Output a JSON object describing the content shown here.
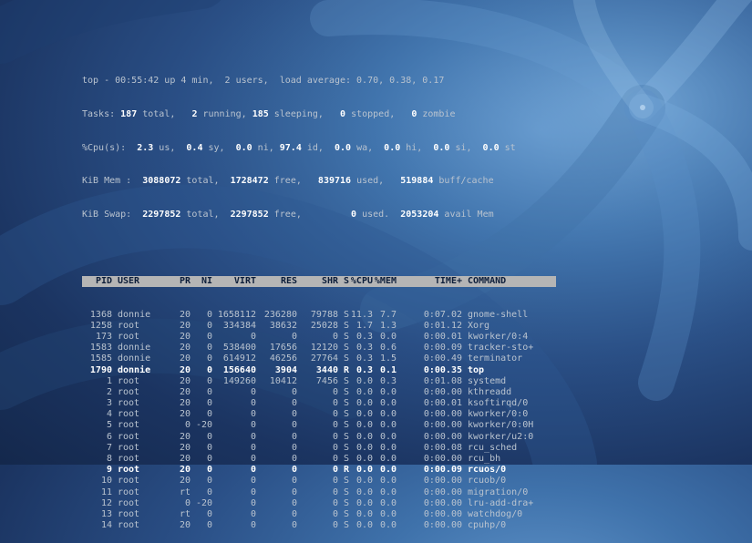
{
  "summary": {
    "top_prefix": "top - 00:55:42 up 4 min,  2 users,  load average: 0.70, 0.38, 0.17",
    "tasks_label": "Tasks: ",
    "tasks_total": "187",
    "tasks_total_label": " total,   ",
    "tasks_running": "2",
    "tasks_running_label": " running, ",
    "tasks_sleeping": "185",
    "tasks_sleeping_label": " sleeping,   ",
    "tasks_stopped": "0",
    "tasks_stopped_label": " stopped,   ",
    "tasks_zombie": "0",
    "tasks_zombie_label": " zombie",
    "cpu_label": "%Cpu(s):  ",
    "cpu_us": "2.3",
    "cpu_us_label": " us,  ",
    "cpu_sy": "0.4",
    "cpu_sy_label": " sy,  ",
    "cpu_ni": "0.0",
    "cpu_ni_label": " ni, ",
    "cpu_id": "97.4",
    "cpu_id_label": " id,  ",
    "cpu_wa": "0.0",
    "cpu_wa_label": " wa,  ",
    "cpu_hi": "0.0",
    "cpu_hi_label": " hi,  ",
    "cpu_si": "0.0",
    "cpu_si_label": " si,  ",
    "cpu_st": "0.0",
    "cpu_st_label": " st",
    "mem_label": "KiB Mem :  ",
    "mem_total": "3088072",
    "mem_total_label": " total,  ",
    "mem_free": "1728472",
    "mem_free_label": " free,   ",
    "mem_used": "839716",
    "mem_used_label": " used,   ",
    "mem_buff": "519884",
    "mem_buff_label": " buff/cache",
    "swap_label": "KiB Swap:  ",
    "swap_total": "2297852",
    "swap_total_label": " total,  ",
    "swap_free": "2297852",
    "swap_free_label": " free,         ",
    "swap_used": "0",
    "swap_used_label": " used.  ",
    "swap_avail": "2053204",
    "swap_avail_label": " avail Mem"
  },
  "columns": [
    "PID",
    "USER",
    "PR",
    "NI",
    "VIRT",
    "RES",
    "SHR",
    "S",
    "%CPU",
    "%MEM",
    "TIME+",
    "COMMAND"
  ],
  "processes": [
    {
      "pid": "1368",
      "user": "donnie",
      "pr": "20",
      "ni": "0",
      "virt": "1658112",
      "res": "236280",
      "shr": "79788",
      "s": "S",
      "cpu": "11.3",
      "mem": "7.7",
      "time": "0:07.02",
      "command": "gnome-shell"
    },
    {
      "pid": "1258",
      "user": "root",
      "pr": "20",
      "ni": "0",
      "virt": "334384",
      "res": "38632",
      "shr": "25028",
      "s": "S",
      "cpu": "1.7",
      "mem": "1.3",
      "time": "0:01.12",
      "command": "Xorg"
    },
    {
      "pid": "173",
      "user": "root",
      "pr": "20",
      "ni": "0",
      "virt": "0",
      "res": "0",
      "shr": "0",
      "s": "S",
      "cpu": "0.3",
      "mem": "0.0",
      "time": "0:00.01",
      "command": "kworker/0:4"
    },
    {
      "pid": "1583",
      "user": "donnie",
      "pr": "20",
      "ni": "0",
      "virt": "538400",
      "res": "17656",
      "shr": "12120",
      "s": "S",
      "cpu": "0.3",
      "mem": "0.6",
      "time": "0:00.09",
      "command": "tracker-sto+"
    },
    {
      "pid": "1585",
      "user": "donnie",
      "pr": "20",
      "ni": "0",
      "virt": "614912",
      "res": "46256",
      "shr": "27764",
      "s": "S",
      "cpu": "0.3",
      "mem": "1.5",
      "time": "0:00.49",
      "command": "terminator"
    },
    {
      "pid": "1790",
      "user": "donnie",
      "pr": "20",
      "ni": "0",
      "virt": "156640",
      "res": "3904",
      "shr": "3440",
      "s": "R",
      "cpu": "0.3",
      "mem": "0.1",
      "time": "0:00.35",
      "command": "top",
      "bold": true
    },
    {
      "pid": "1",
      "user": "root",
      "pr": "20",
      "ni": "0",
      "virt": "149260",
      "res": "10412",
      "shr": "7456",
      "s": "S",
      "cpu": "0.0",
      "mem": "0.3",
      "time": "0:01.08",
      "command": "systemd"
    },
    {
      "pid": "2",
      "user": "root",
      "pr": "20",
      "ni": "0",
      "virt": "0",
      "res": "0",
      "shr": "0",
      "s": "S",
      "cpu": "0.0",
      "mem": "0.0",
      "time": "0:00.00",
      "command": "kthreadd"
    },
    {
      "pid": "3",
      "user": "root",
      "pr": "20",
      "ni": "0",
      "virt": "0",
      "res": "0",
      "shr": "0",
      "s": "S",
      "cpu": "0.0",
      "mem": "0.0",
      "time": "0:00.01",
      "command": "ksoftirqd/0"
    },
    {
      "pid": "4",
      "user": "root",
      "pr": "20",
      "ni": "0",
      "virt": "0",
      "res": "0",
      "shr": "0",
      "s": "S",
      "cpu": "0.0",
      "mem": "0.0",
      "time": "0:00.00",
      "command": "kworker/0:0"
    },
    {
      "pid": "5",
      "user": "root",
      "pr": "0",
      "ni": "-20",
      "virt": "0",
      "res": "0",
      "shr": "0",
      "s": "S",
      "cpu": "0.0",
      "mem": "0.0",
      "time": "0:00.00",
      "command": "kworker/0:0H"
    },
    {
      "pid": "6",
      "user": "root",
      "pr": "20",
      "ni": "0",
      "virt": "0",
      "res": "0",
      "shr": "0",
      "s": "S",
      "cpu": "0.0",
      "mem": "0.0",
      "time": "0:00.00",
      "command": "kworker/u2:0"
    },
    {
      "pid": "7",
      "user": "root",
      "pr": "20",
      "ni": "0",
      "virt": "0",
      "res": "0",
      "shr": "0",
      "s": "S",
      "cpu": "0.0",
      "mem": "0.0",
      "time": "0:00.08",
      "command": "rcu_sched"
    },
    {
      "pid": "8",
      "user": "root",
      "pr": "20",
      "ni": "0",
      "virt": "0",
      "res": "0",
      "shr": "0",
      "s": "S",
      "cpu": "0.0",
      "mem": "0.0",
      "time": "0:00.00",
      "command": "rcu_bh"
    },
    {
      "pid": "9",
      "user": "root",
      "pr": "20",
      "ni": "0",
      "virt": "0",
      "res": "0",
      "shr": "0",
      "s": "R",
      "cpu": "0.0",
      "mem": "0.0",
      "time": "0:00.09",
      "command": "rcuos/0",
      "bold": true
    },
    {
      "pid": "10",
      "user": "root",
      "pr": "20",
      "ni": "0",
      "virt": "0",
      "res": "0",
      "shr": "0",
      "s": "S",
      "cpu": "0.0",
      "mem": "0.0",
      "time": "0:00.00",
      "command": "rcuob/0"
    },
    {
      "pid": "11",
      "user": "root",
      "pr": "rt",
      "ni": "0",
      "virt": "0",
      "res": "0",
      "shr": "0",
      "s": "S",
      "cpu": "0.0",
      "mem": "0.0",
      "time": "0:00.00",
      "command": "migration/0"
    },
    {
      "pid": "12",
      "user": "root",
      "pr": "0",
      "ni": "-20",
      "virt": "0",
      "res": "0",
      "shr": "0",
      "s": "S",
      "cpu": "0.0",
      "mem": "0.0",
      "time": "0:00.00",
      "command": "lru-add-dra+"
    },
    {
      "pid": "13",
      "user": "root",
      "pr": "rt",
      "ni": "0",
      "virt": "0",
      "res": "0",
      "shr": "0",
      "s": "S",
      "cpu": "0.0",
      "mem": "0.0",
      "time": "0:00.00",
      "command": "watchdog/0"
    },
    {
      "pid": "14",
      "user": "root",
      "pr": "20",
      "ni": "0",
      "virt": "0",
      "res": "0",
      "shr": "0",
      "s": "S",
      "cpu": "0.0",
      "mem": "0.0",
      "time": "0:00.00",
      "command": "cpuhp/0"
    }
  ]
}
